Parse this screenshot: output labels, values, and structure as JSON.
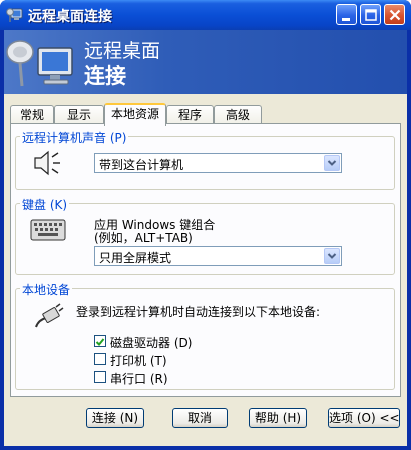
{
  "window": {
    "title": "远程桌面连接",
    "min_icon": "minimize-icon",
    "max_icon": "maximize-icon",
    "close_icon": "close-icon"
  },
  "banner": {
    "line1": "远程桌面",
    "line2": "连接"
  },
  "tabs": [
    {
      "label": "常规",
      "active": false
    },
    {
      "label": "显示",
      "active": false
    },
    {
      "label": "本地资源",
      "active": true
    },
    {
      "label": "程序",
      "active": false
    },
    {
      "label": "高级",
      "active": false
    }
  ],
  "sound": {
    "label": "远程计算机声音 (P)",
    "icon": "speaker-icon",
    "selected": "带到这台计算机"
  },
  "keyboard": {
    "label": "键盘 (K)",
    "icon": "keyboard-icon",
    "line1": "应用 Windows 键组合",
    "line2": "(例如，ALT+TAB)",
    "selected": "只用全屏模式"
  },
  "devices": {
    "label": "本地设备",
    "icon": "plug-icon",
    "description": "登录到远程计算机时自动连接到以下本地设备:",
    "items": [
      {
        "label": "磁盘驱动器 (D)",
        "checked": true
      },
      {
        "label": "打印机 (T)",
        "checked": false
      },
      {
        "label": "串行口 (R)",
        "checked": false
      }
    ]
  },
  "buttons": {
    "connect": "连接 (N)",
    "cancel": "取消",
    "help": "帮助 (H)",
    "options": "选项 (O) <<"
  }
}
